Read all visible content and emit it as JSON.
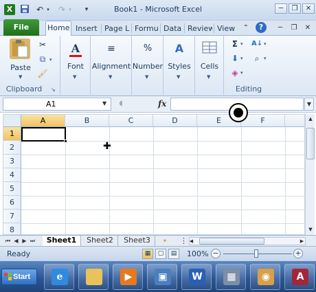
{
  "titlebar": {
    "title": "Book1 - Microsoft Excel",
    "qat": [
      "excel-logo-icon",
      "save-icon",
      "undo-icon",
      "redo-icon",
      "customize-qat-icon"
    ],
    "buttons": {
      "minimize": "─",
      "restore": "❐",
      "close": "✕"
    }
  },
  "tabs": {
    "file": "File",
    "items": [
      "Home",
      "Insert",
      "Page L",
      "Formu",
      "Data",
      "Review",
      "View"
    ],
    "active": "Home"
  },
  "ribbon": {
    "clipboard": {
      "label": "Clipboard",
      "paste": "Paste"
    },
    "font": "Font",
    "alignment": "Alignment",
    "number": "Number",
    "styles": "Styles",
    "cells": "Cells",
    "editing": {
      "label": "Editing"
    }
  },
  "formula_bar": {
    "name_box": "A1",
    "fx": "fx",
    "formula": ""
  },
  "grid": {
    "columns": [
      "A",
      "B",
      "C",
      "D",
      "E",
      "F"
    ],
    "rows": [
      "1",
      "2",
      "3",
      "4",
      "5",
      "6",
      "7",
      "8"
    ],
    "selected_cell": "A1"
  },
  "sheets": {
    "tabs": [
      "Sheet1",
      "Sheet2",
      "Sheet3"
    ],
    "active": "Sheet1"
  },
  "status": {
    "ready": "Ready",
    "zoom": "100%",
    "zoom_minus": "−",
    "zoom_plus": "+"
  },
  "taskbar": {
    "start": "Start",
    "apps": [
      "internet-explorer-icon",
      "file-explorer-icon",
      "media-player-icon",
      "remote-desktop-icon",
      "word-icon",
      "calculator-icon",
      "paint-icon",
      "access-icon"
    ]
  },
  "colors": {
    "file_tab": "#1f6f1b",
    "selected_header": "#f1c15f",
    "taskbar": "#2b5797"
  }
}
